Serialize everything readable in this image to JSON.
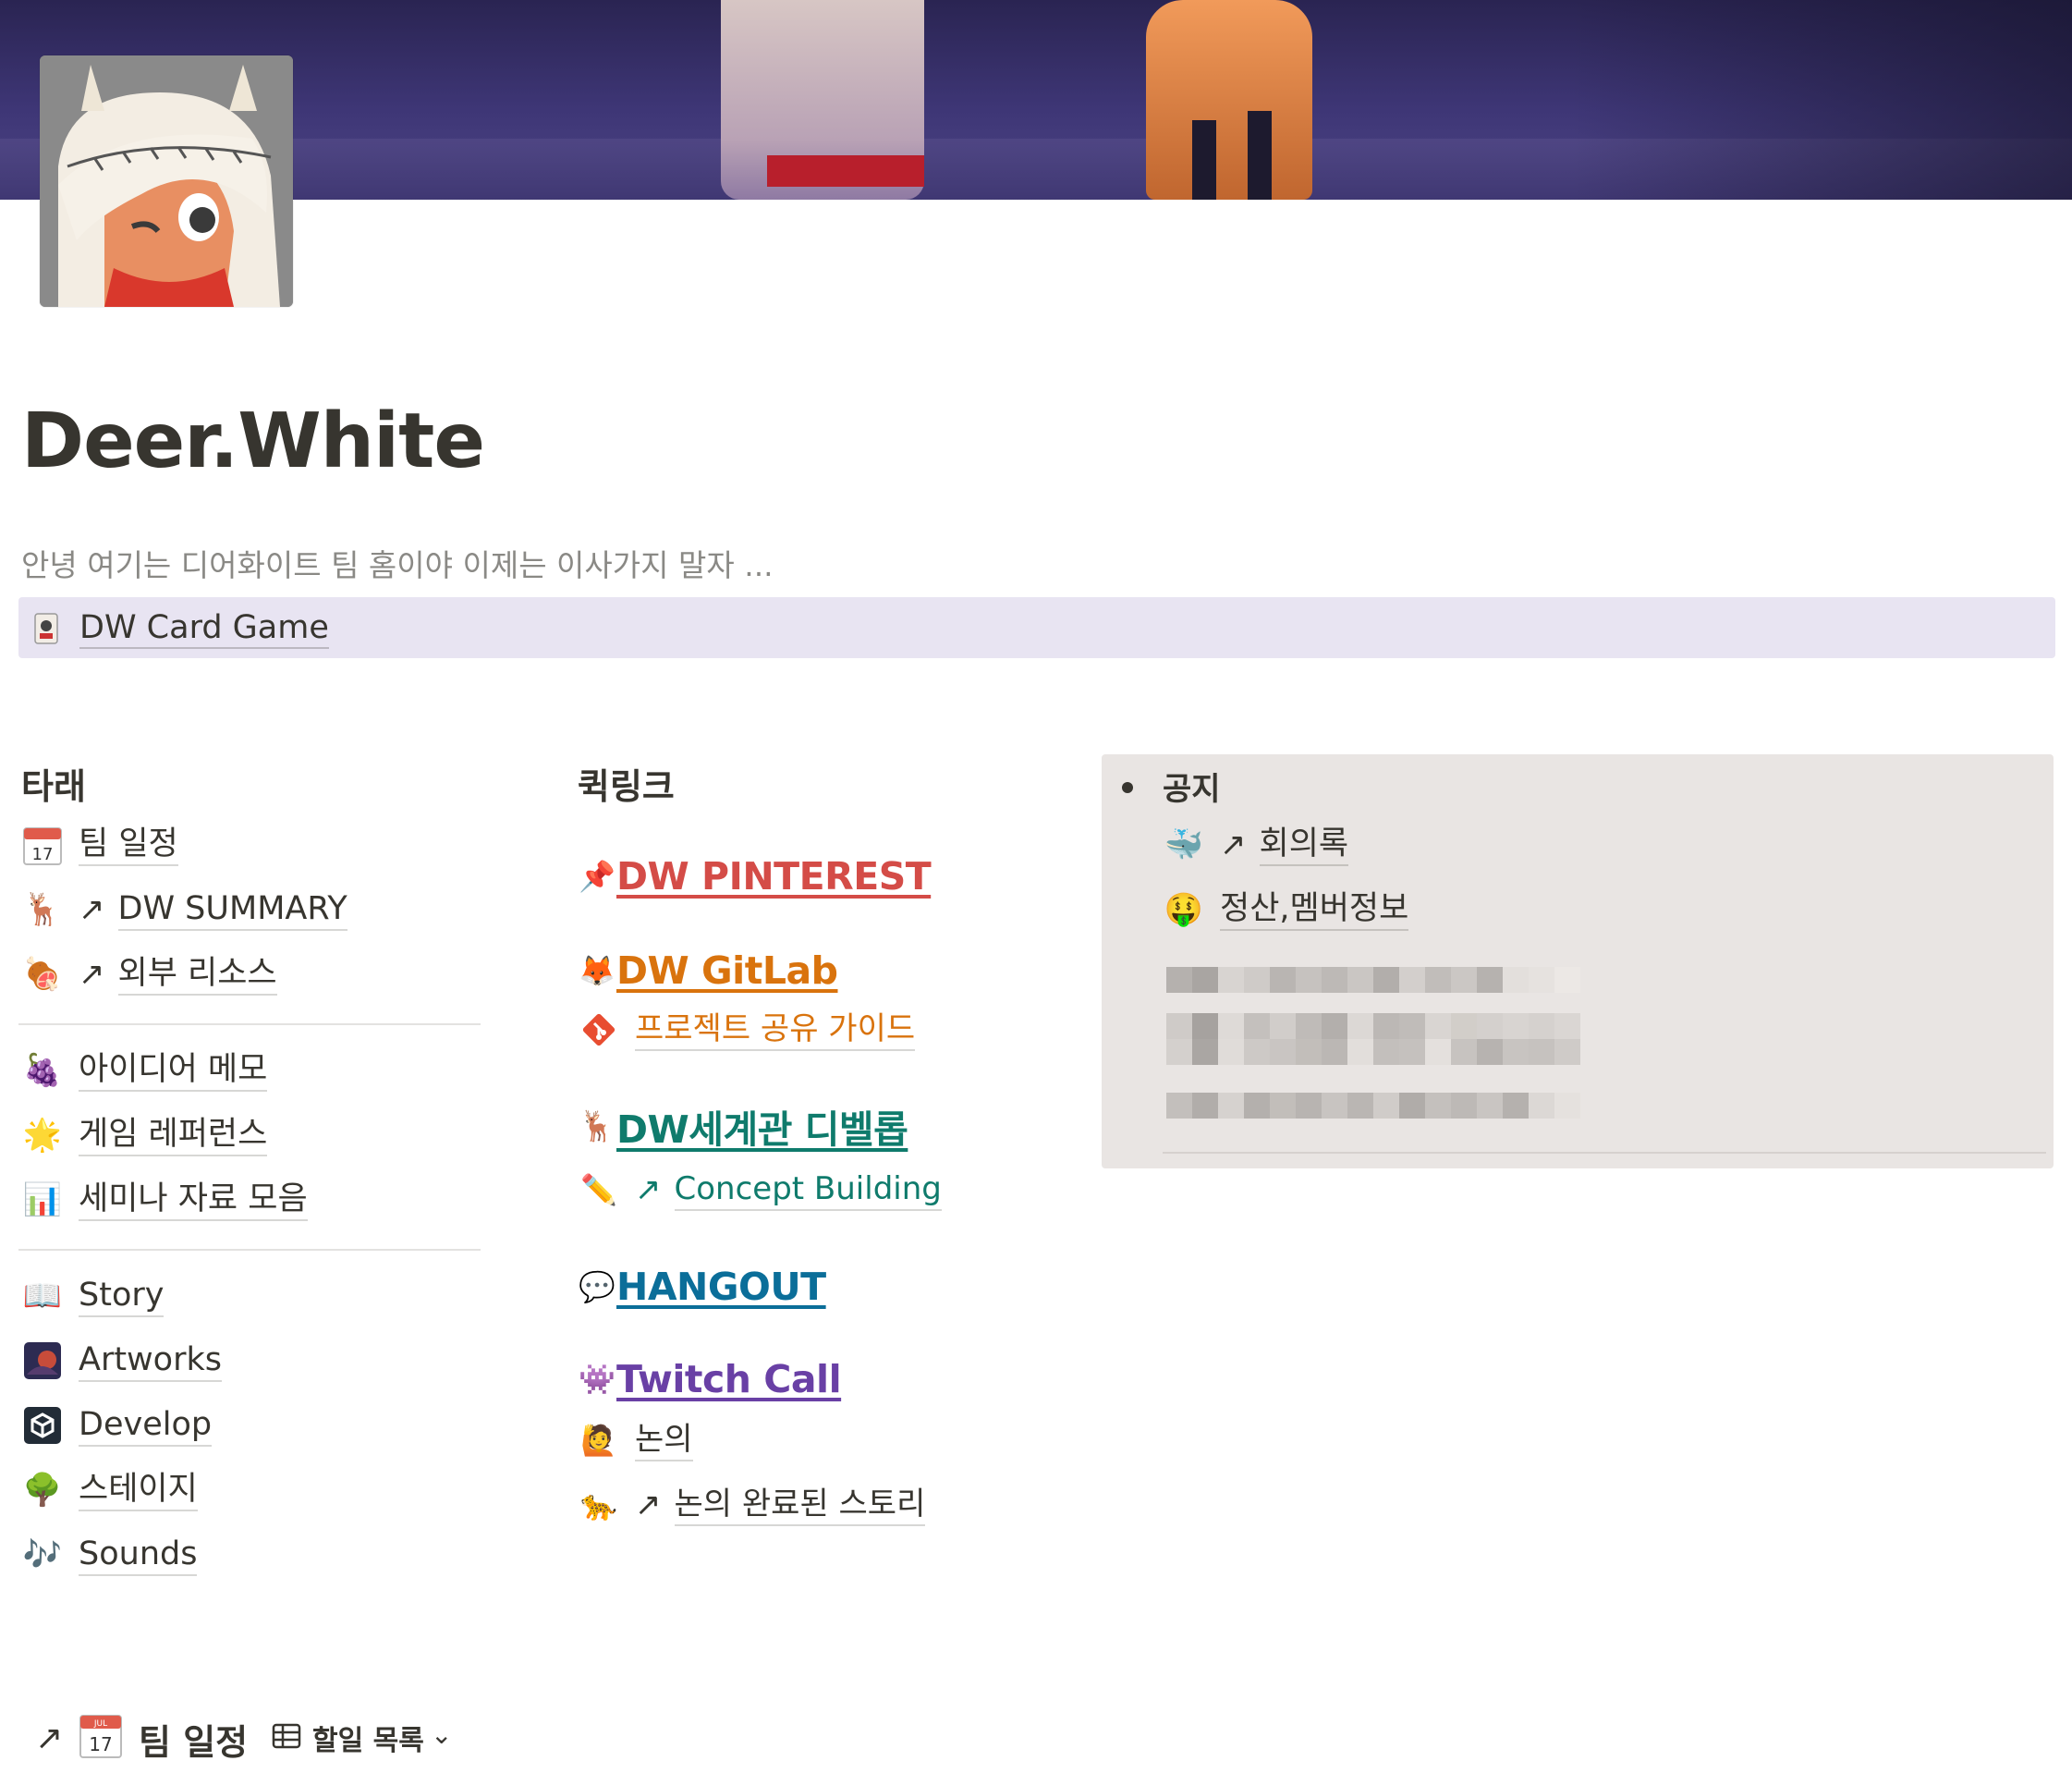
{
  "page": {
    "title": "Deer.White",
    "subtitle": "안녕 여기는 디어화이트 팀 홈이야 이제는 이사가지 말자 ...",
    "callout_link": "DW Card Game"
  },
  "left_column": {
    "heading": "타래",
    "group1": [
      {
        "icon": "📅",
        "arrow": false,
        "label": "팀 일정"
      },
      {
        "icon": "🦌",
        "arrow": true,
        "label": "DW SUMMARY"
      },
      {
        "icon": "🍖",
        "arrow": true,
        "label": "외부 리소스"
      }
    ],
    "group2": [
      {
        "icon": "🍇",
        "arrow": false,
        "label": "아이디어 메모"
      },
      {
        "icon": "🌟",
        "arrow": false,
        "label": "게임 레퍼런스"
      },
      {
        "icon": "📊",
        "arrow": false,
        "label": "세미나 자료 모음"
      }
    ],
    "group3": [
      {
        "icon": "📖",
        "arrow": false,
        "label": "Story"
      },
      {
        "icon": "🖼",
        "arrow": false,
        "label": "Artworks"
      },
      {
        "icon": "⚙",
        "arrow": false,
        "label": "Develop"
      },
      {
        "icon": "🌳",
        "arrow": false,
        "label": "스테이지"
      },
      {
        "icon": "🎶",
        "arrow": false,
        "label": "Sounds"
      }
    ]
  },
  "quick_links": {
    "heading": "퀵링크",
    "pinterest": {
      "icon": "📌",
      "label": "DW PINTEREST",
      "color": "#d44c47"
    },
    "gitlab": {
      "icon": "🦊",
      "label": "DW GitLab",
      "color": "#d9730d"
    },
    "gitlab_sub": {
      "icon": "◆",
      "label": "프로젝트 공유 가이드",
      "color": "#d9730d"
    },
    "worldview": {
      "icon": "🦌",
      "label": "DW세계관 디벨롭",
      "color": "#0f7b6c"
    },
    "worldview_sub": {
      "icon": "✏️",
      "label": "Concept Building",
      "color": "#0f7b6c"
    },
    "hangout": {
      "icon": "💬",
      "label": "HANGOUT",
      "color": "#0b6e99"
    },
    "twitch": {
      "icon": "👾",
      "label": "Twitch Call",
      "color": "#6940a5"
    },
    "twitch_sub1": {
      "icon": "🙋",
      "label": "논의"
    },
    "twitch_sub2": {
      "icon": "🐆",
      "label": "논의 완료된 스토리"
    }
  },
  "notice": {
    "title": "공지",
    "items": [
      {
        "icon": "🐳",
        "arrow": true,
        "label": "회의록"
      },
      {
        "icon": "🤑",
        "arrow": false,
        "label": "정산,멤버정보"
      }
    ]
  },
  "bottom": {
    "arrow": "↗",
    "title": "팀 일정",
    "view": "할일 목록",
    "calendar_month": "JUL",
    "calendar_day": "17"
  },
  "colors": {
    "callout_bg": "#e8e4f2",
    "notice_bg": "#e9e5e3"
  }
}
